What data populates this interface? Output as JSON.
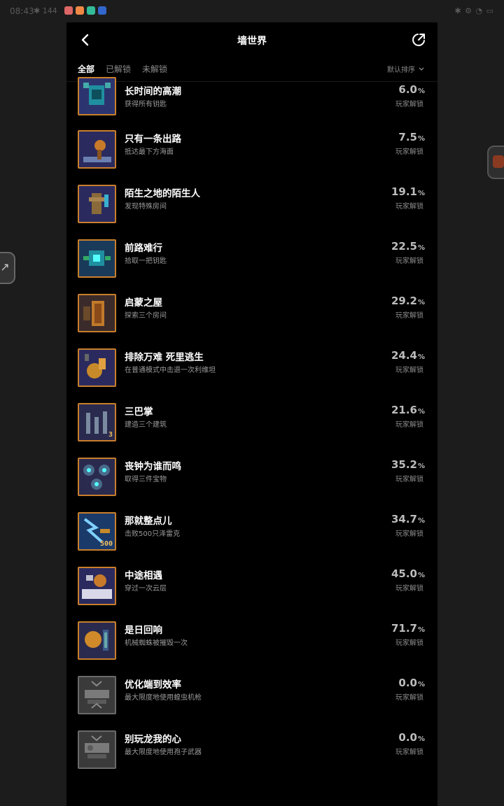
{
  "status_bar": {
    "time": "08:43",
    "icons_left": "✱ 144",
    "icons_right": "✱ ⚙ ◔ ▭"
  },
  "colors": {
    "panel_bg": "#000000",
    "icon_border": "#c97f2c",
    "icon_border_locked": "#6a6a6a",
    "text_primary": "#ffffff",
    "text_secondary": "#9a9a9a",
    "pct_color": "#bcbcbc"
  },
  "header": {
    "title": "墙世界",
    "back_icon": "chevron-left-icon",
    "share_icon": "share-icon"
  },
  "tabs": [
    {
      "label": "全部",
      "active": true
    },
    {
      "label": "已解锁",
      "active": false
    },
    {
      "label": "未解锁",
      "active": false
    }
  ],
  "sort": {
    "label": "默认排序"
  },
  "percent_unit": "%",
  "percent_label": "玩家解锁",
  "achievements": [
    {
      "name": "长时间的高潮",
      "desc": "获得所有钥匙",
      "pct": "6.0",
      "locked": false
    },
    {
      "name": "只有一条出路",
      "desc": "抵达最下方海面",
      "pct": "7.5",
      "locked": false
    },
    {
      "name": "陌生之地的陌生人",
      "desc": "发现特殊房间",
      "pct": "19.1",
      "locked": false
    },
    {
      "name": "前路难行",
      "desc": "拾取一把钥匙",
      "pct": "22.5",
      "locked": false
    },
    {
      "name": "启蒙之屋",
      "desc": "探索三个房间",
      "pct": "29.2",
      "locked": false
    },
    {
      "name": "排除万难 死里逃生",
      "desc": "在普通模式中击退一次利维坦",
      "pct": "24.4",
      "locked": false
    },
    {
      "name": "三巴掌",
      "desc": "建造三个建筑",
      "pct": "21.6",
      "locked": false,
      "icon_text": "3"
    },
    {
      "name": "丧钟为谁而鸣",
      "desc": "取得三件宝物",
      "pct": "35.2",
      "locked": false
    },
    {
      "name": "那就整点儿",
      "desc": "击败500只泽雷克",
      "pct": "34.7",
      "locked": false,
      "icon_text": "500"
    },
    {
      "name": "中途相遇",
      "desc": "穿过一次云层",
      "pct": "45.0",
      "locked": false
    },
    {
      "name": "是日回响",
      "desc": "机械蜘蛛被摧毁一次",
      "pct": "71.7",
      "locked": false
    },
    {
      "name": "优化端到效率",
      "desc": "最大限度地使用蝗虫机枪",
      "pct": "0.0",
      "locked": true
    },
    {
      "name": "别玩龙我的心",
      "desc": "最大限度地使用孢子武器",
      "pct": "0.0",
      "locked": true
    }
  ]
}
